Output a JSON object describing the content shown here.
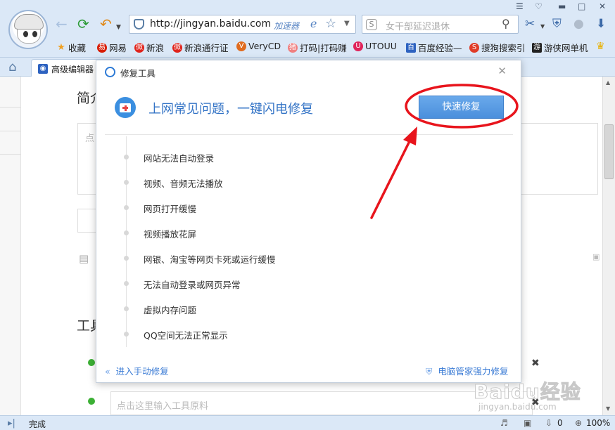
{
  "browser": {
    "url": "http://jingyan.baidu.com",
    "accelerator_label": "加速器",
    "search_placeholder": "女干部延迟退休",
    "bookmarks": [
      {
        "label": "收藏",
        "color": "#f0a020",
        "glyph": "★"
      },
      {
        "label": "网易",
        "color": "#d81e06",
        "glyph": "易"
      },
      {
        "label": "新浪",
        "color": "#e0241c",
        "glyph": "微"
      },
      {
        "label": "新浪通行证",
        "color": "#e0241c",
        "glyph": "微"
      },
      {
        "label": "VeryCD",
        "color": "#e06b1e",
        "glyph": "V"
      },
      {
        "label": "打码|打码赚",
        "color": "#f08080",
        "glyph": "猪"
      },
      {
        "label": "UTOUU",
        "color": "#e0245a",
        "glyph": "U"
      },
      {
        "label": "百度经验—",
        "color": "#2d62c0",
        "glyph": "百"
      },
      {
        "label": "搜狗搜索引",
        "color": "#e03c28",
        "glyph": "S"
      },
      {
        "label": "游侠网单机",
        "color": "#222222",
        "glyph": "游"
      }
    ],
    "tab_label": "高级编辑器",
    "status_text": "完成",
    "status_count": "0",
    "zoom": "100%"
  },
  "page": {
    "intro_heading": "简介",
    "tools_heading": "工具",
    "input_placeholder": "点",
    "tool_input_placeholder": "点击这里输入工具原料"
  },
  "dialog": {
    "title": "修复工具",
    "headline": "上网常见问题，一键闪电修复",
    "fix_button": "快速修复",
    "issues": [
      "网站无法自动登录",
      "视频、音频无法播放",
      "网页打开缓慢",
      "视频播放花屏",
      "网银、淘宝等网页卡死或运行缓慢",
      "无法自动登录或网页异常",
      "虚拟内存问题",
      "QQ空间无法正常显示"
    ],
    "manual_link": "进入手动修复",
    "manager_link": "电脑管家强力修复"
  },
  "watermark": {
    "main": "Baidu经验",
    "sub": "jingyan.baidu.com"
  },
  "colors": {
    "accent_blue": "#3474c6",
    "button_blue": "#4a8fdc",
    "annotation_red": "#e8141c",
    "chrome_bg": "#dbe8f7"
  }
}
